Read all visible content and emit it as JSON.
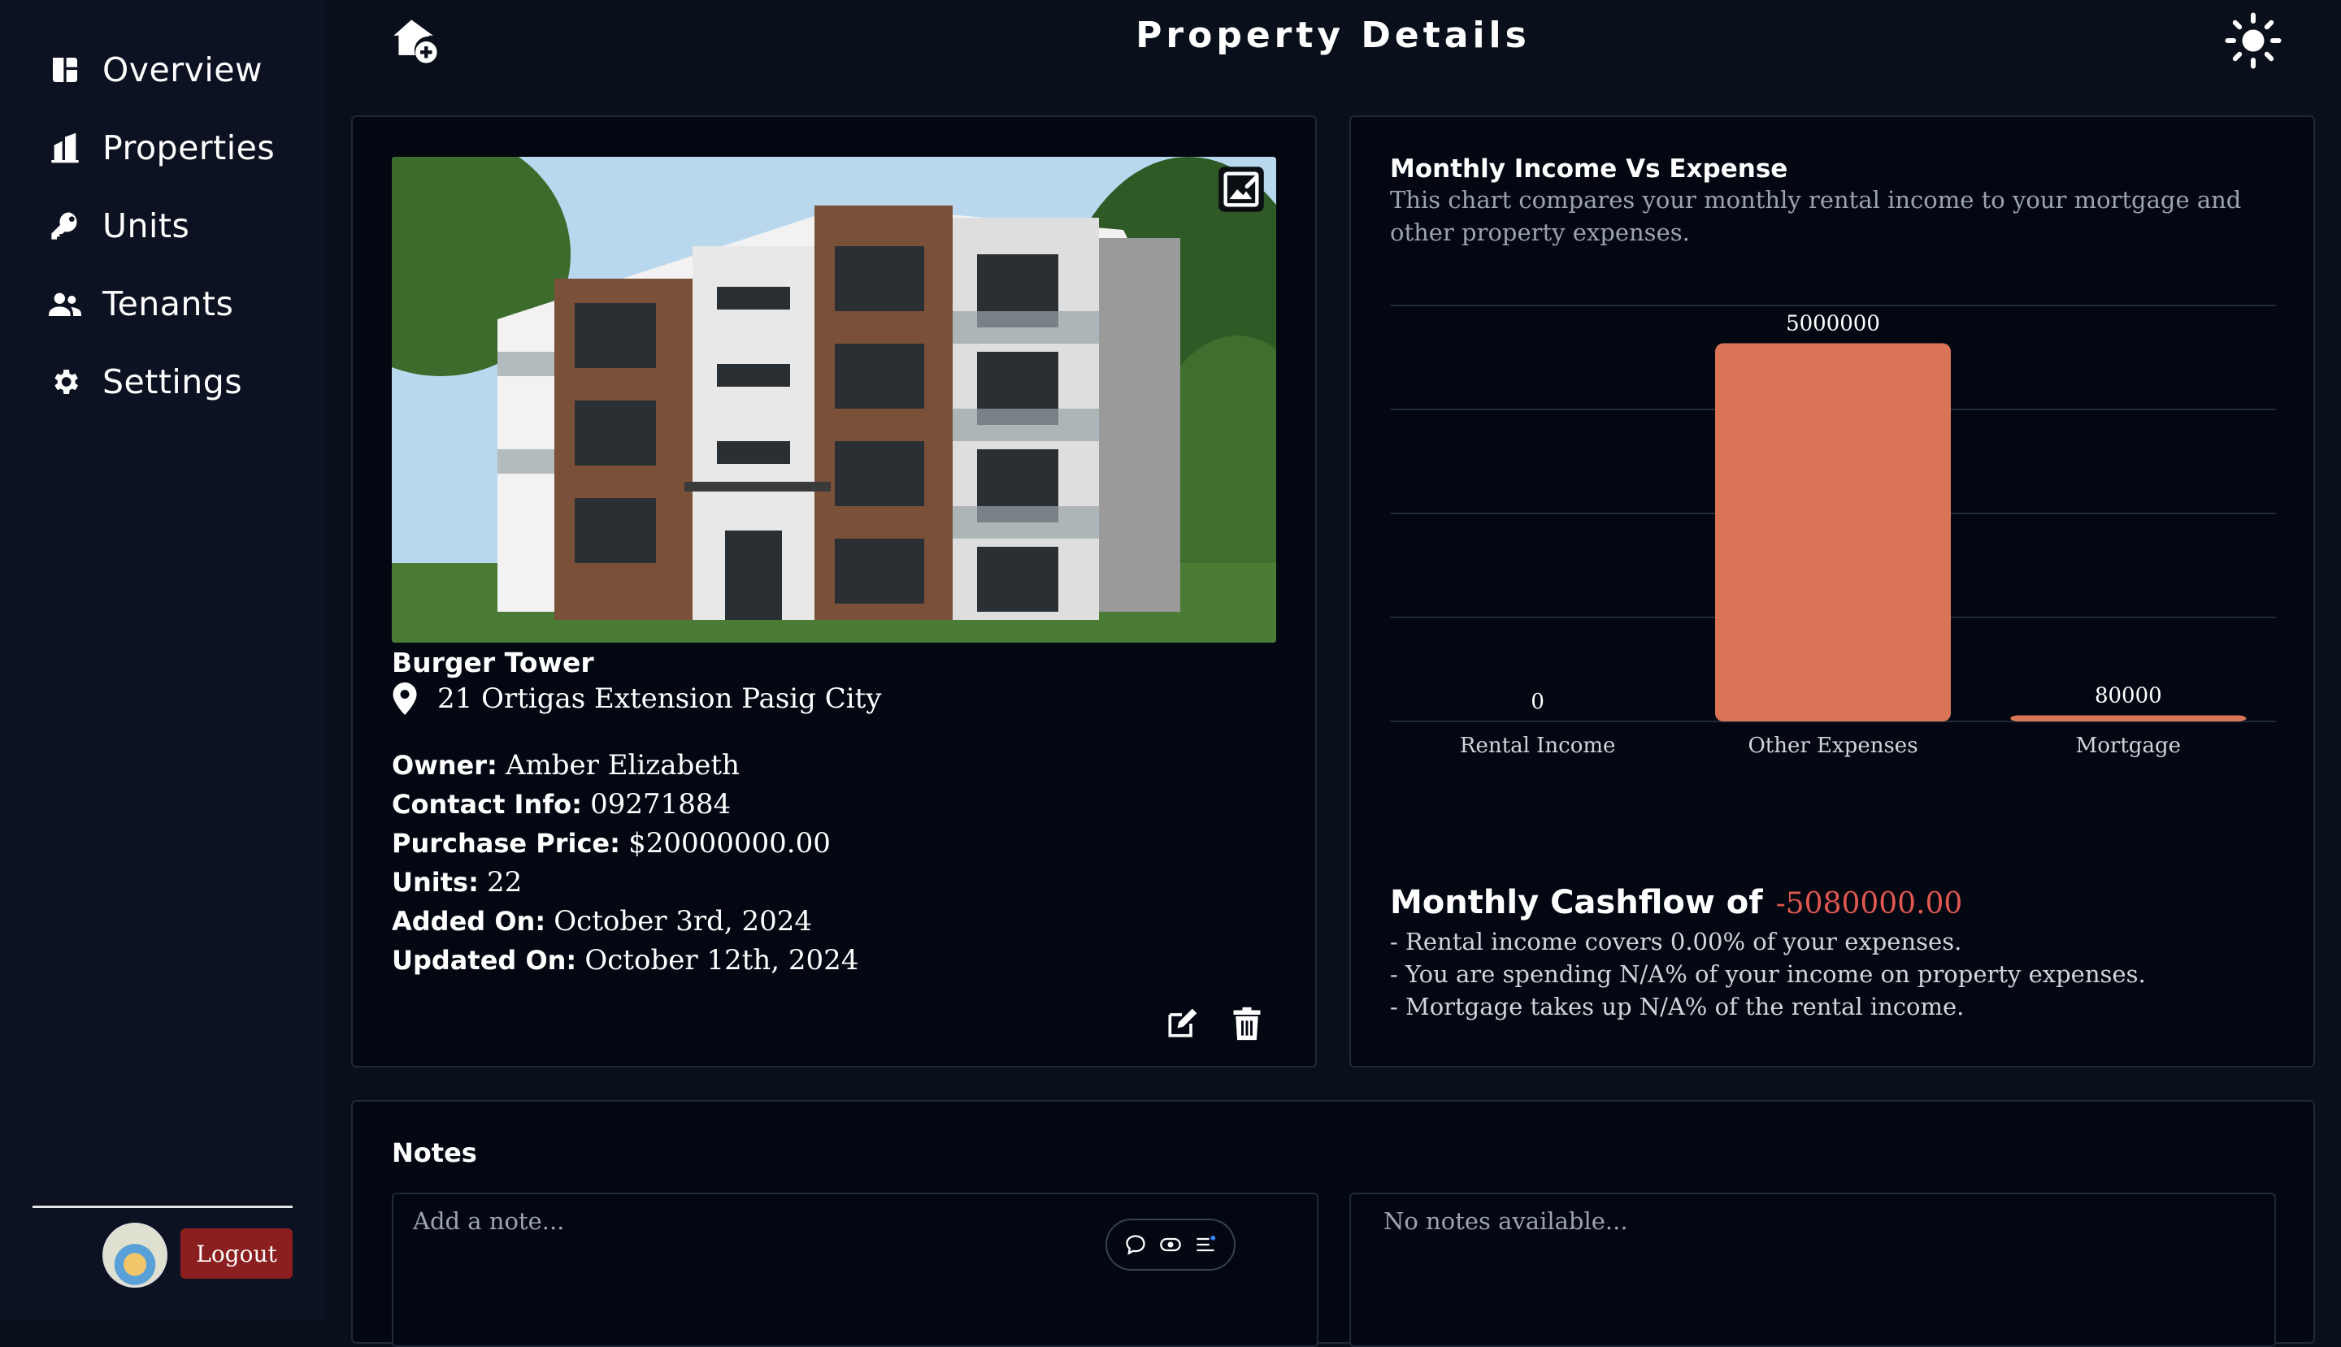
{
  "sidebar": {
    "items": [
      {
        "label": "Overview",
        "icon": "dashboard-icon"
      },
      {
        "label": "Properties",
        "icon": "building-icon"
      },
      {
        "label": "Units",
        "icon": "key-icon"
      },
      {
        "label": "Tenants",
        "icon": "users-icon"
      },
      {
        "label": "Settings",
        "icon": "gear-icon"
      }
    ],
    "logout_label": "Logout"
  },
  "header": {
    "title": "Property Details"
  },
  "property": {
    "name": "Burger Tower",
    "address": "21 Ortigas Extension Pasig City",
    "details": [
      {
        "key": "Owner:",
        "value": "Amber Elizabeth"
      },
      {
        "key": "Contact Info:",
        "value": "09271884"
      },
      {
        "key": "Purchase Price:",
        "value": "$20000000.00"
      },
      {
        "key": "Units:",
        "value": "22"
      },
      {
        "key": "Added On:",
        "value": "October 3rd, 2024"
      },
      {
        "key": "Updated On:",
        "value": "October 12th, 2024"
      }
    ]
  },
  "chart": {
    "title": "Monthly Income Vs Expense",
    "description": "This chart compares your monthly rental income to your mortgage and other property expenses."
  },
  "chart_data": {
    "type": "bar",
    "categories": [
      "Rental Income",
      "Other Expenses",
      "Mortgage"
    ],
    "values": [
      0,
      5000000,
      80000
    ],
    "data_labels": [
      "0",
      "5000000",
      "80000"
    ],
    "ylim": [
      0,
      5000000
    ],
    "grid": true,
    "bar_color": "#d97556"
  },
  "cashflow": {
    "label": "Monthly Cashflow of",
    "value": "-5080000.00",
    "insights": [
      "- Rental income covers 0.00% of your expenses.",
      "- You are spending N/A% of your income on property expenses.",
      "- Mortgage takes up N/A% of the rental income."
    ]
  },
  "notes": {
    "title": "Notes",
    "placeholder": "Add a note...",
    "empty_text": "No notes available..."
  },
  "colors": {
    "background": "#0a0f1c",
    "sidebar": "#0c1221",
    "card": "#030712",
    "bar": "#d97556",
    "negative": "#e0584f",
    "logout": "#8b1f1f"
  }
}
